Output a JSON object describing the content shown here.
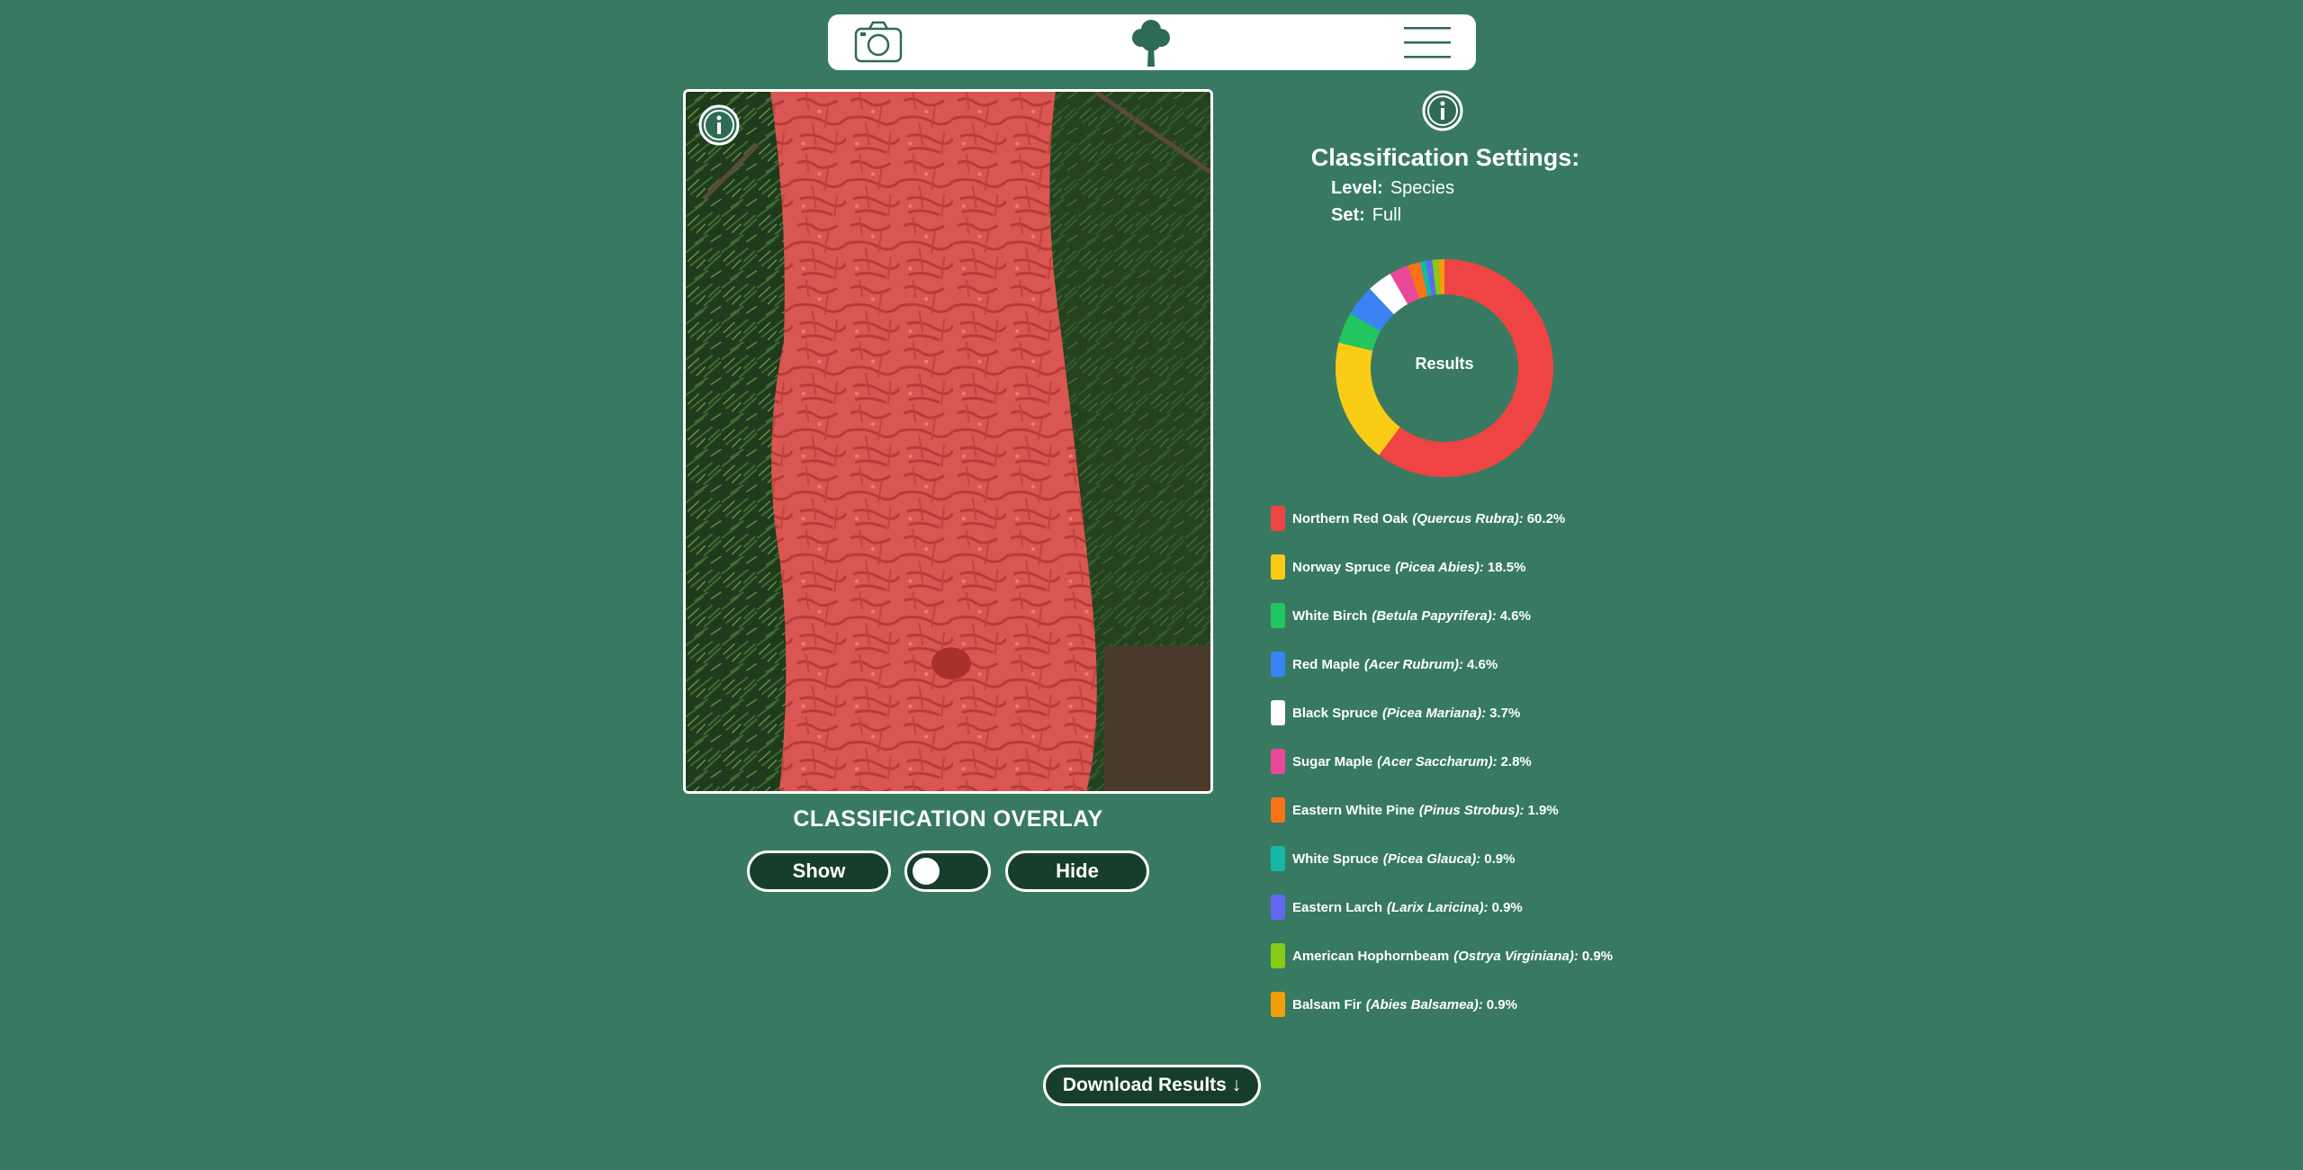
{
  "nav": {
    "camera_icon": "camera-icon",
    "logo_icon": "tree-icon",
    "menu_icon": "hamburger-menu-icon"
  },
  "photo": {
    "info_icon": "info-icon",
    "overlay_color": "#e05a5a"
  },
  "overlay": {
    "title": "CLASSIFICATION OVERLAY",
    "show_label": "Show",
    "hide_label": "Hide",
    "toggle_on": false
  },
  "settings": {
    "title": "Classification Settings:",
    "level_key": "Level:",
    "level_value": "Species",
    "set_key": "Set:",
    "set_value": "Full"
  },
  "download": {
    "label": "Download Results ↓"
  },
  "chart_data": {
    "type": "pie",
    "center_label": "Results",
    "series": [
      {
        "name": "Northern Red Oak",
        "latin": "(Quercus Rubra):",
        "value": 60.2,
        "value_text": "60.2%",
        "color": "#ef4444"
      },
      {
        "name": "Norway Spruce",
        "latin": "(Picea Abies):",
        "value": 18.5,
        "value_text": "18.5%",
        "color": "#facc15"
      },
      {
        "name": "White Birch",
        "latin": "(Betula Papyrifera):",
        "value": 4.6,
        "value_text": "4.6%",
        "color": "#22c55e"
      },
      {
        "name": "Red Maple",
        "latin": "(Acer Rubrum):",
        "value": 4.6,
        "value_text": "4.6%",
        "color": "#3b82f6"
      },
      {
        "name": "Black Spruce",
        "latin": "(Picea Mariana):",
        "value": 3.7,
        "value_text": "3.7%",
        "color": "#ffffff"
      },
      {
        "name": "Sugar Maple",
        "latin": "(Acer Saccharum):",
        "value": 2.8,
        "value_text": "2.8%",
        "color": "#ec4899"
      },
      {
        "name": "Eastern White Pine",
        "latin": "(Pinus Strobus):",
        "value": 1.9,
        "value_text": "1.9%",
        "color": "#f97316"
      },
      {
        "name": "White Spruce",
        "latin": "(Picea Glauca):",
        "value": 0.9,
        "value_text": "0.9%",
        "color": "#14b8a6"
      },
      {
        "name": "Eastern Larch",
        "latin": "(Larix Laricina):",
        "value": 0.9,
        "value_text": "0.9%",
        "color": "#6366f1"
      },
      {
        "name": "American Hophornbeam",
        "latin": "(Ostrya Virginiana):",
        "value": 0.9,
        "value_text": "0.9%",
        "color": "#84cc16"
      },
      {
        "name": "Balsam Fir",
        "latin": "(Abies Balsamea):",
        "value": 0.9,
        "value_text": "0.9%",
        "color": "#f59e0b"
      }
    ]
  }
}
